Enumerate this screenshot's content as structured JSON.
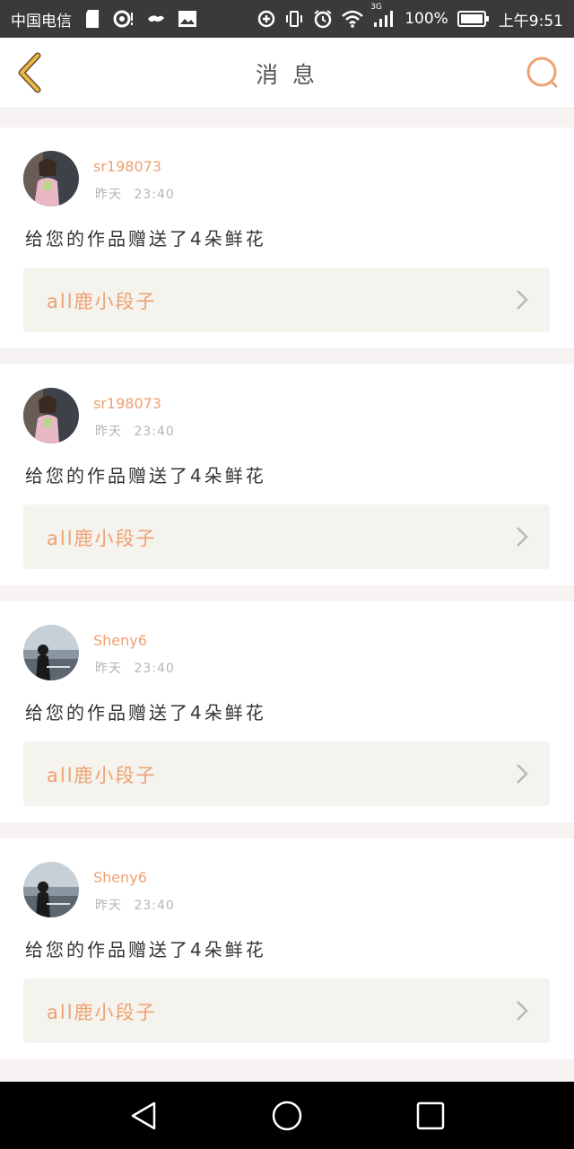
{
  "status_bar": {
    "carrier": "中国电信",
    "network": "3G",
    "battery": "100%",
    "time": "上午9:51"
  },
  "header": {
    "title": "消 息",
    "back_icon": "chevron-left-icon",
    "search_icon": "search-icon"
  },
  "colors": {
    "accent": "#f0a070",
    "back_chevron": "#e8b84a"
  },
  "messages": [
    {
      "username": "sr198073",
      "time_day": "昨天",
      "time": "23:40",
      "text": "给您的作品赠送了4朵鲜花",
      "work_title": "all鹿小段子"
    },
    {
      "username": "sr198073",
      "time_day": "昨天",
      "time": "23:40",
      "text": "给您的作品赠送了4朵鲜花",
      "work_title": "all鹿小段子"
    },
    {
      "username": "Sheny6",
      "time_day": "昨天",
      "time": "23:40",
      "text": "给您的作品赠送了4朵鲜花",
      "work_title": "all鹿小段子"
    },
    {
      "username": "Sheny6",
      "time_day": "昨天",
      "time": "23:40",
      "text": "给您的作品赠送了4朵鲜花",
      "work_title": "all鹿小段子"
    }
  ]
}
